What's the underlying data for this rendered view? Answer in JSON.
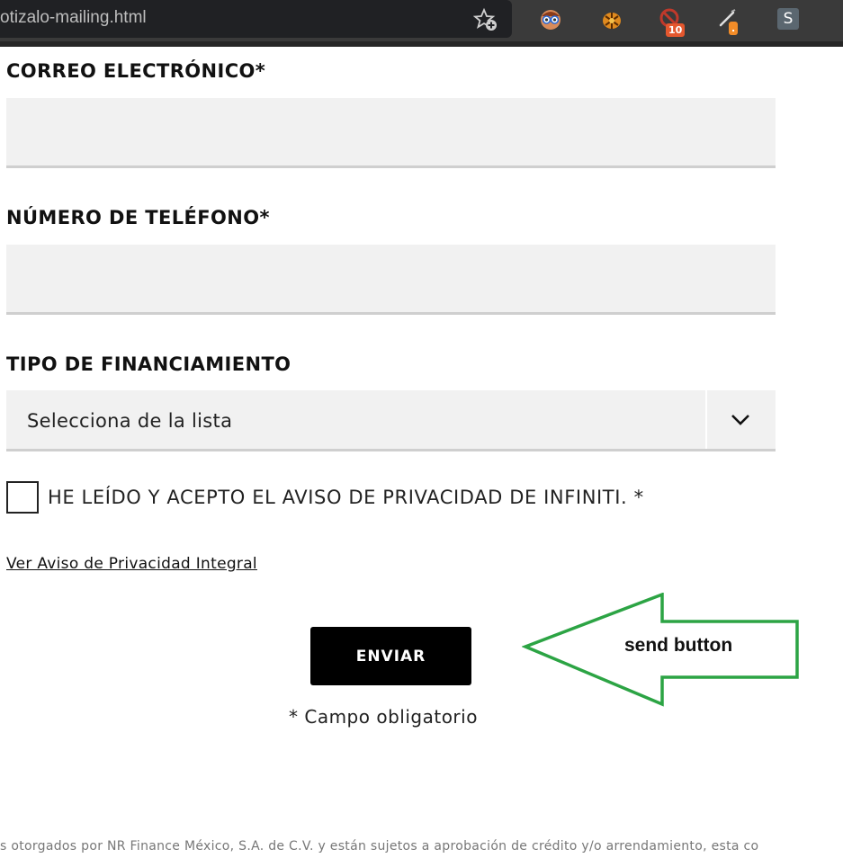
{
  "browser": {
    "url_fragment": "otizalo-mailing.html",
    "extensions": [
      {
        "name": "glasses-face-extension-icon",
        "badge": ""
      },
      {
        "name": "bug-extension-icon",
        "badge": ""
      },
      {
        "name": "blocker-extension-icon",
        "badge": "10"
      },
      {
        "name": "pencil-extension-icon",
        "badge": "."
      }
    ],
    "profile_letter": "S"
  },
  "form": {
    "email_label": "CORREO ELECTRÓNICO*",
    "email_value": "",
    "phone_label": "NÚMERO DE TELÉFONO*",
    "phone_value": "",
    "financing_label": "TIPO DE FINANCIAMIENTO",
    "financing_selected": "Selecciona de la lista",
    "consent_text": "HE LEÍDO Y ACEPTO EL AVISO DE PRIVACIDAD DE INFINITI. *",
    "consent_checked": false,
    "privacy_link": "Ver Aviso de Privacidad Integral",
    "send_label": "ENVIAR",
    "required_note": "* Campo obligatorio"
  },
  "annotation": {
    "label": "send button",
    "color": "#2ca444"
  },
  "footer": {
    "disclaimer": "s otorgados por NR Finance México, S.A. de C.V. y están sujetos a aprobación de crédito y/o arrendamiento, esta co"
  },
  "colors": {
    "accent": "#000000",
    "field_bg": "#f1f1f1",
    "toolbar_bg": "#3a3a3a"
  }
}
